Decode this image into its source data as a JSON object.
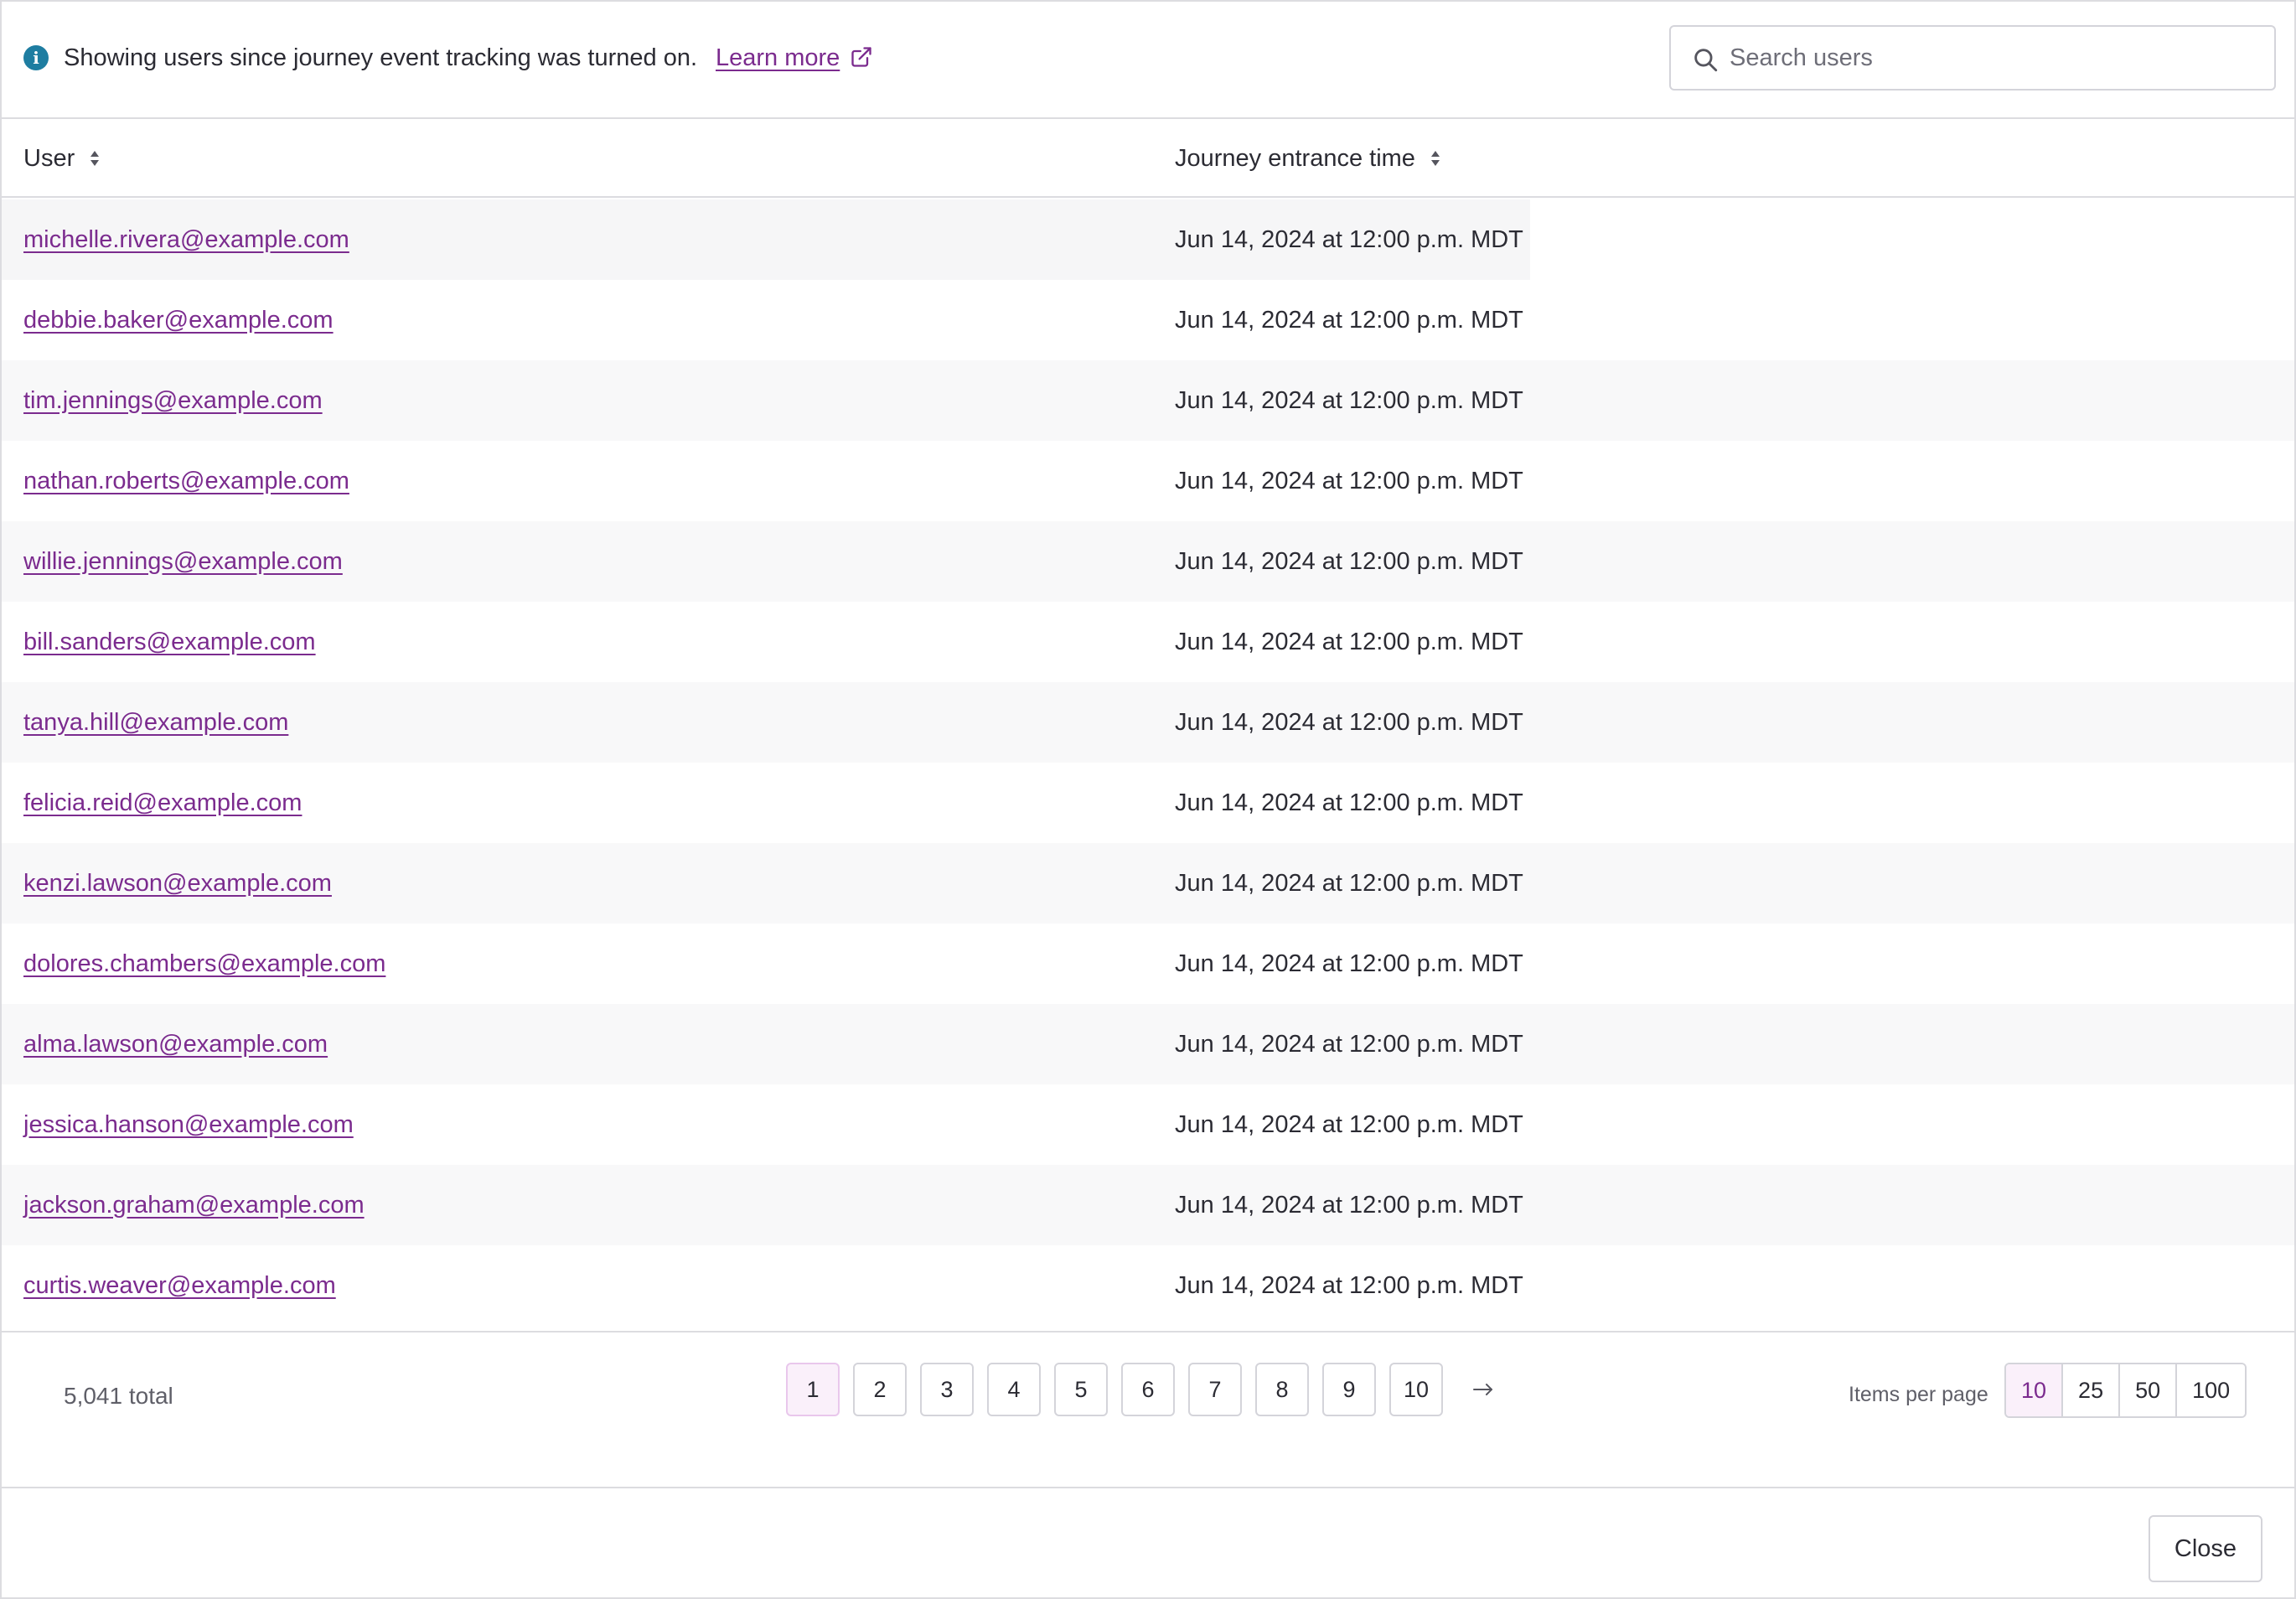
{
  "banner": {
    "message": "Showing users since journey event tracking was turned on.",
    "link_label": "Learn more"
  },
  "search": {
    "placeholder": "Search users",
    "value": ""
  },
  "table": {
    "columns": [
      "User",
      "Journey entrance time"
    ],
    "rows": [
      {
        "user": "michelle.rivera@example.com",
        "time": "Jun 14, 2024 at 12:00 p.m. MDT"
      },
      {
        "user": "debbie.baker@example.com",
        "time": "Jun 14, 2024 at 12:00 p.m. MDT"
      },
      {
        "user": "tim.jennings@example.com",
        "time": "Jun 14, 2024 at 12:00 p.m. MDT"
      },
      {
        "user": "nathan.roberts@example.com",
        "time": "Jun 14, 2024 at 12:00 p.m. MDT"
      },
      {
        "user": "willie.jennings@example.com",
        "time": "Jun 14, 2024 at 12:00 p.m. MDT"
      },
      {
        "user": "bill.sanders@example.com",
        "time": "Jun 14, 2024 at 12:00 p.m. MDT"
      },
      {
        "user": "tanya.hill@example.com",
        "time": "Jun 14, 2024 at 12:00 p.m. MDT"
      },
      {
        "user": "felicia.reid@example.com",
        "time": "Jun 14, 2024 at 12:00 p.m. MDT"
      },
      {
        "user": "kenzi.lawson@example.com",
        "time": "Jun 14, 2024 at 12:00 p.m. MDT"
      },
      {
        "user": "dolores.chambers@example.com",
        "time": "Jun 14, 2024 at 12:00 p.m. MDT"
      },
      {
        "user": "alma.lawson@example.com",
        "time": "Jun 14, 2024 at 12:00 p.m. MDT"
      },
      {
        "user": "jessica.hanson@example.com",
        "time": "Jun 14, 2024 at 12:00 p.m. MDT"
      },
      {
        "user": "jackson.graham@example.com",
        "time": "Jun 14, 2024 at 12:00 p.m. MDT"
      },
      {
        "user": "curtis.weaver@example.com",
        "time": "Jun 14, 2024 at 12:00 p.m. MDT"
      }
    ]
  },
  "pagination": {
    "total": "5,041 total",
    "pages": [
      "1",
      "2",
      "3",
      "4",
      "5",
      "6",
      "7",
      "8",
      "9",
      "10"
    ],
    "current_page": "1",
    "items_per_page_label": "Items per page",
    "items_per_page_options": [
      "10",
      "25",
      "50",
      "100"
    ],
    "items_per_page_selected": "10"
  },
  "footer": {
    "close_label": "Close"
  },
  "colors": {
    "accent": "#7b2b8e",
    "info": "#1e7da1",
    "selected_bg": "#faf0fa",
    "border": "#dcdce0"
  },
  "icons": {
    "info": "info-icon",
    "external_link": "external-link-icon",
    "search": "search-icon",
    "sort": "sort-icon",
    "next": "arrow-right-icon"
  }
}
